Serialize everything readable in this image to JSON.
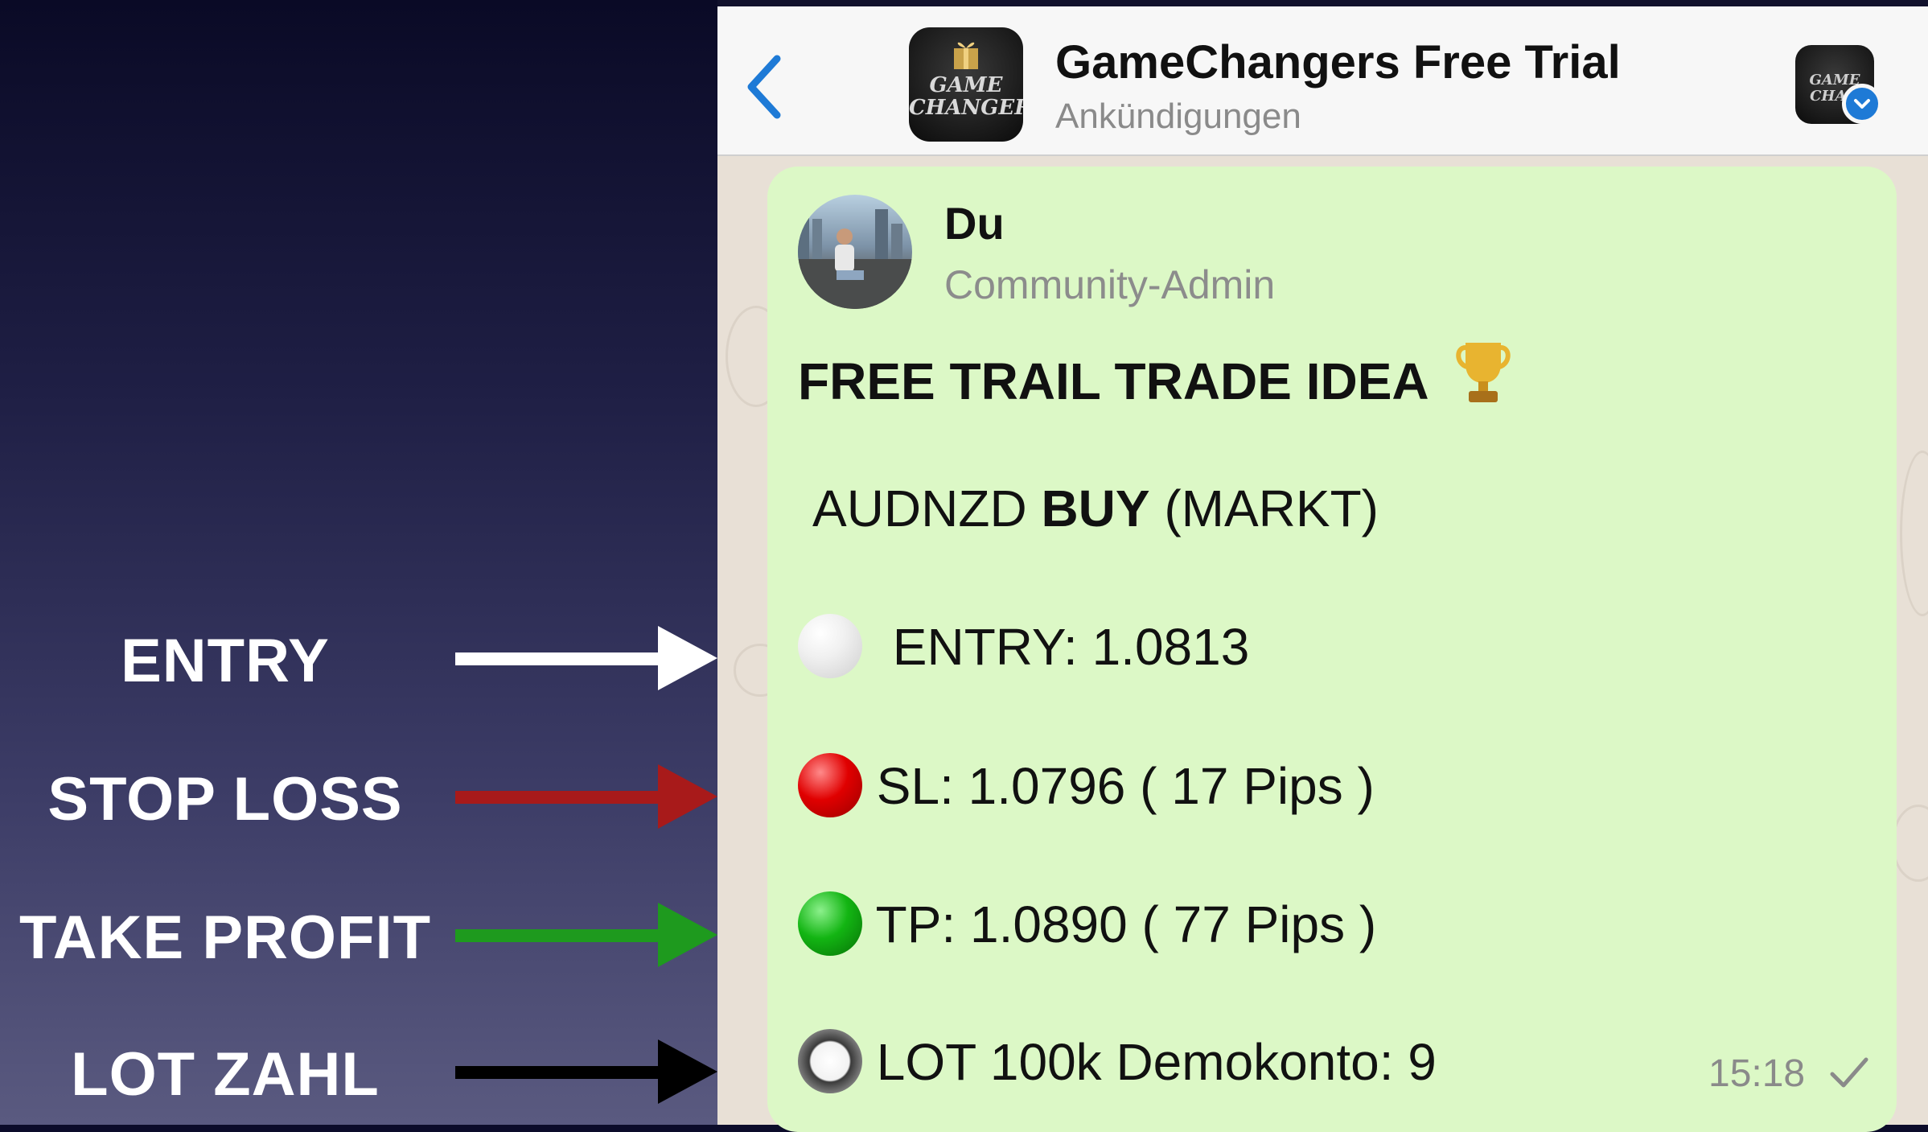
{
  "annotations": [
    {
      "label": "ENTRY",
      "color": "#ffffff"
    },
    {
      "label": "STOP LOSS",
      "color": "#a81a1a"
    },
    {
      "label": "TAKE PROFIT",
      "color": "#1e9a1e"
    },
    {
      "label": "LOT ZAHL",
      "color": "#000000"
    }
  ],
  "header": {
    "title": "GameChangers Free Trial",
    "subtitle": "Ankündigungen",
    "avatar_text": "GAME CHANGERS",
    "community_text": "GAME CHAN"
  },
  "message": {
    "sender": "Du",
    "role": "Community-Admin",
    "title": "FREE TRAIL TRADE IDEA",
    "title_icon": "🏆",
    "pair": "AUDNZD",
    "action": "BUY",
    "order_type": "(MARKT)",
    "entry": "ENTRY: 1.0813",
    "sl": "SL: 1.0796 ( 17 Pips )",
    "tp": "TP: 1.0890 ( 77 Pips )",
    "lot": "LOT 100k Demokonto: 9",
    "time": "15:18"
  },
  "icons": {
    "back": "chevron-left-icon",
    "verified": "chevron-down-badge-icon",
    "read": "checkmark-icon",
    "trophy": "trophy-icon"
  },
  "colors": {
    "bubble": "#dcf8c6",
    "accent": "#1e7ad6",
    "left_bg": "#1f1f45"
  }
}
